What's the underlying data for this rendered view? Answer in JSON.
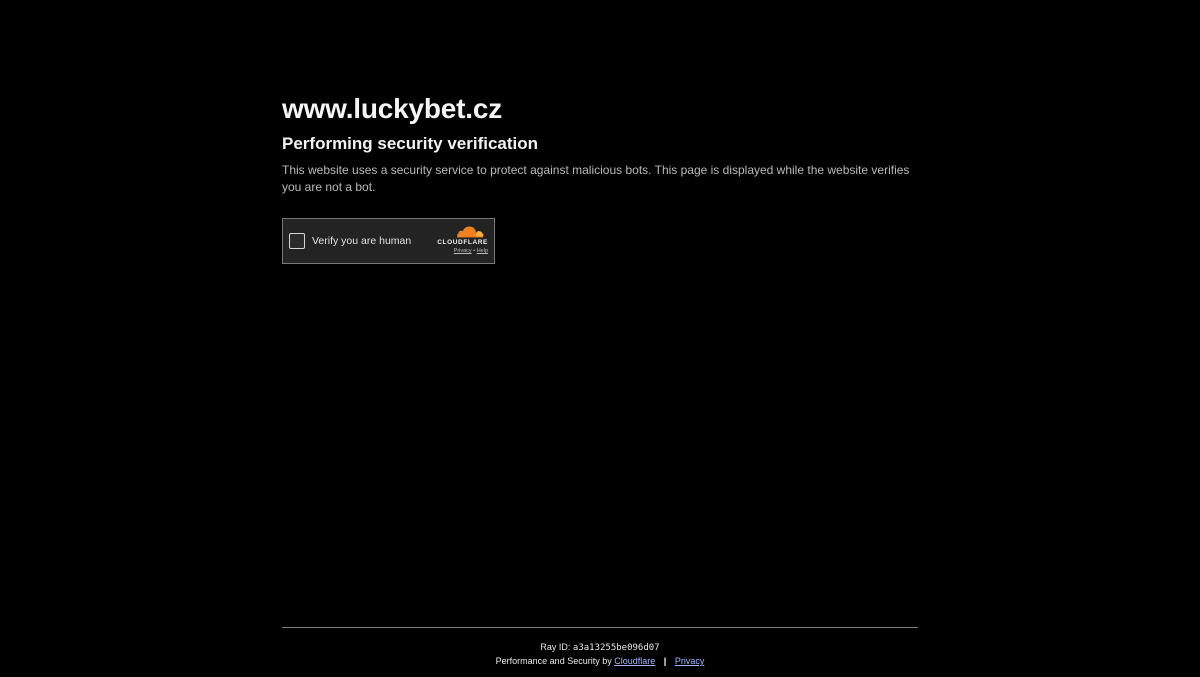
{
  "site": {
    "title": "www.luckybet.cz"
  },
  "main": {
    "heading": "Performing security verification",
    "description": "This website uses a security service to protect against malicious bots. This page is displayed while the website verifies you are not a bot."
  },
  "widget": {
    "checkbox_label": "Verify you are human",
    "brand_name": "CLOUDFLARE",
    "privacy_link": "Privacy",
    "link_separator": "•",
    "help_link": "Help",
    "brand_icon": "cloudflare-cloud-icon",
    "brand_color": "#f38020"
  },
  "footer": {
    "ray_label": "Ray ID:",
    "ray_id": "a3a13255be096d07",
    "perf_text": "Performance and Security by",
    "cloudflare_link": "Cloudflare",
    "separator": "|",
    "privacy_link": "Privacy"
  },
  "colors": {
    "background": "#000000",
    "link": "#9fb6ff"
  }
}
